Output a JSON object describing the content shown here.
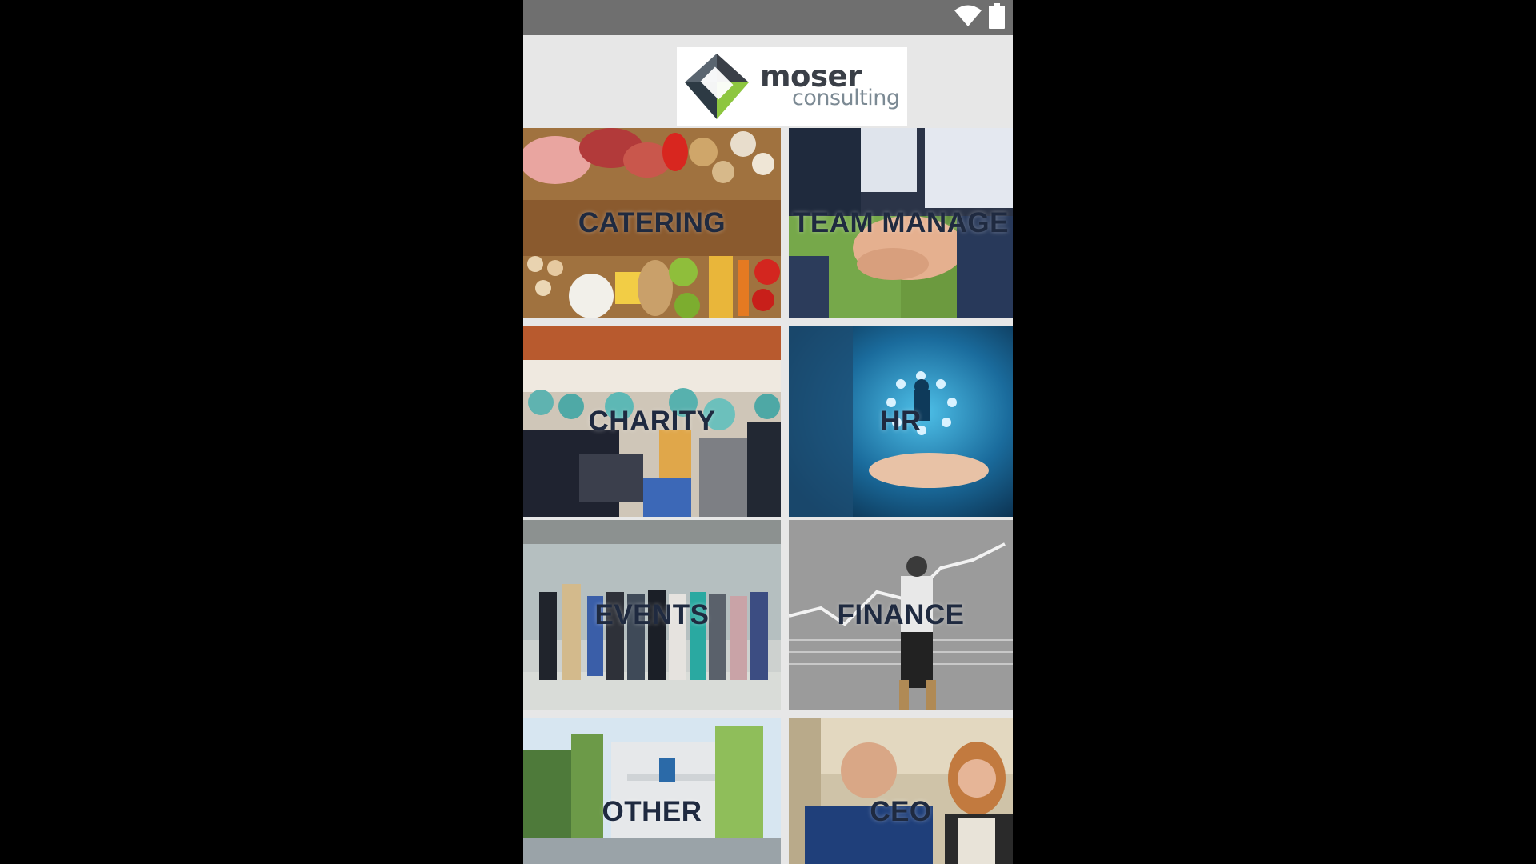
{
  "status_bar": {
    "icons": [
      "wifi-icon",
      "battery-icon"
    ]
  },
  "header": {
    "logo": {
      "word1": "moser",
      "word2": "consulting"
    }
  },
  "tiles": [
    {
      "label": "CATERING",
      "theme": "food"
    },
    {
      "label": "TEAM MANAGE",
      "theme": "team-hands"
    },
    {
      "label": "CHARITY",
      "theme": "volunteers"
    },
    {
      "label": "HR",
      "theme": "hand-network"
    },
    {
      "label": "EVENTS",
      "theme": "ribbon-cutting"
    },
    {
      "label": "FINANCE",
      "theme": "chalkboard"
    },
    {
      "label": "OTHER",
      "theme": "office-building"
    },
    {
      "label": "CEO",
      "theme": "portrait"
    }
  ],
  "colors": {
    "status_bar": "#6f6f6f",
    "header_bg": "#e7e7e7",
    "label_text": "#1f2a40",
    "logo_dark": "#3a3f47",
    "logo_green": "#8dc63f",
    "logo_light": "#7c8a94"
  }
}
